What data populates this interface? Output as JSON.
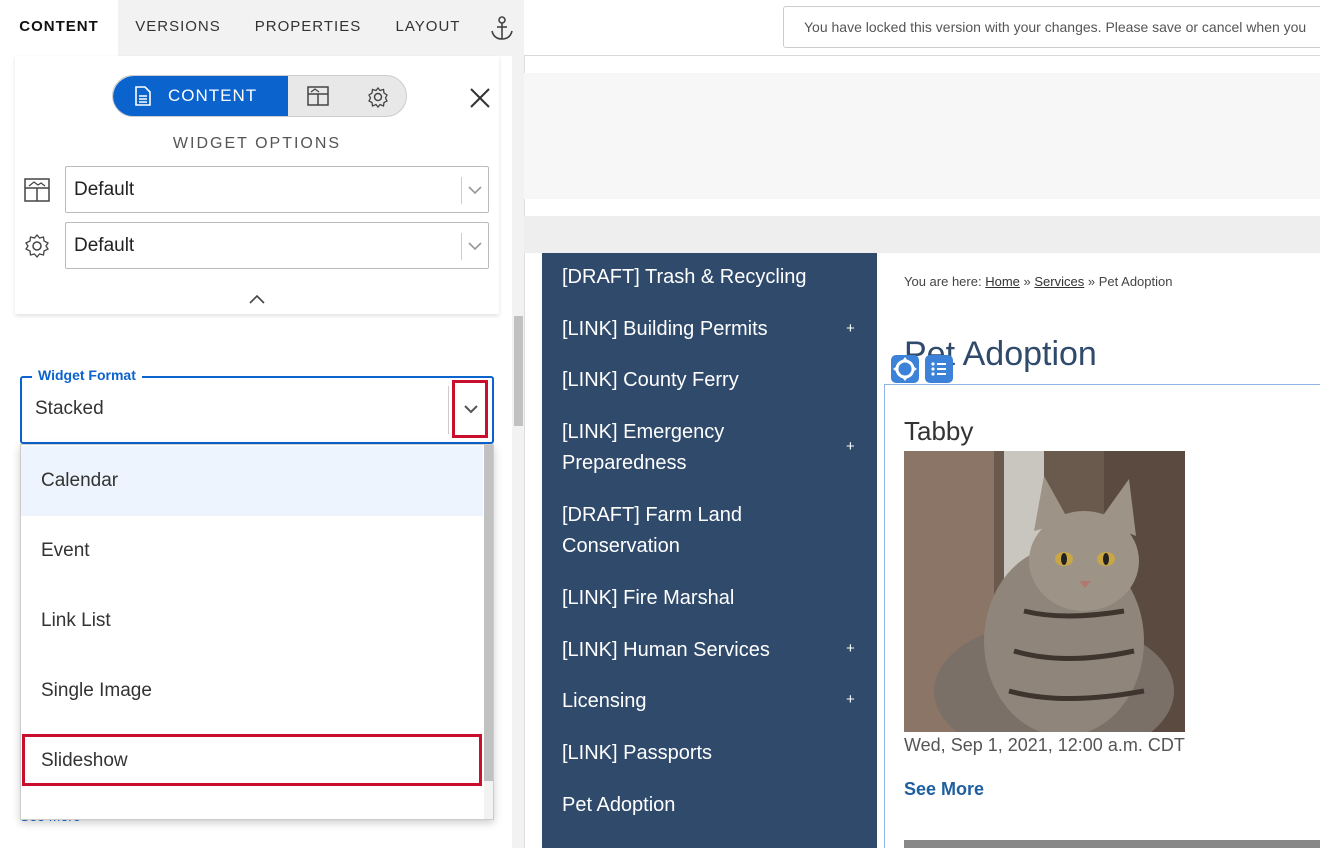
{
  "topbar": {
    "tabs": [
      {
        "label": "CONTENT",
        "active": true
      },
      {
        "label": "VERSIONS",
        "active": false
      },
      {
        "label": "PROPERTIES",
        "active": false
      },
      {
        "label": "LAYOUT",
        "active": false
      }
    ],
    "banner_text": "You have locked this version with your changes. Please save or cancel when you"
  },
  "panel": {
    "segment_active_label": "CONTENT",
    "widget_options_title": "WIDGET OPTIONS",
    "layout_select_value": "Default",
    "settings_select_value": "Default"
  },
  "widget_format": {
    "label": "Widget Format",
    "value": "Stacked",
    "options": [
      "Calendar",
      "Event",
      "Link List",
      "Single Image",
      "Slideshow"
    ],
    "highlighted_option": "Calendar",
    "outlined_option": "Slideshow",
    "peek_text": "See More"
  },
  "preview": {
    "nav_items": [
      {
        "label": "[DRAFT] Trash & Recycling",
        "plus": ""
      },
      {
        "label": "[LINK] Building Permits",
        "plus": "+"
      },
      {
        "label": "[LINK] County Ferry",
        "plus": ""
      },
      {
        "label": "[LINK] Emergency Preparedness",
        "plus": "+"
      },
      {
        "label": "[DRAFT] Farm Land Conservation",
        "plus": ""
      },
      {
        "label": "[LINK] Fire Marshal",
        "plus": ""
      },
      {
        "label": "[LINK] Human Services",
        "plus": "+"
      },
      {
        "label": "Licensing",
        "plus": "+"
      },
      {
        "label": "[LINK] Passports",
        "plus": ""
      },
      {
        "label": "Pet Adoption",
        "plus": ""
      }
    ],
    "breadcrumb": {
      "prefix": "You are here:",
      "home": "Home",
      "sep1": "»",
      "services": "Services",
      "sep2": "»",
      "current": "Pet Adoption"
    },
    "page_title": "Pet Adoption",
    "item_title": "Tabby",
    "item_date": "Wed, Sep 1, 2021, 12:00 a.m. CDT",
    "item_more": "See More"
  },
  "colors": {
    "accent": "#0b63ce",
    "highlight_outline": "#c8102e",
    "nav_bg": "#2f4a6b"
  }
}
